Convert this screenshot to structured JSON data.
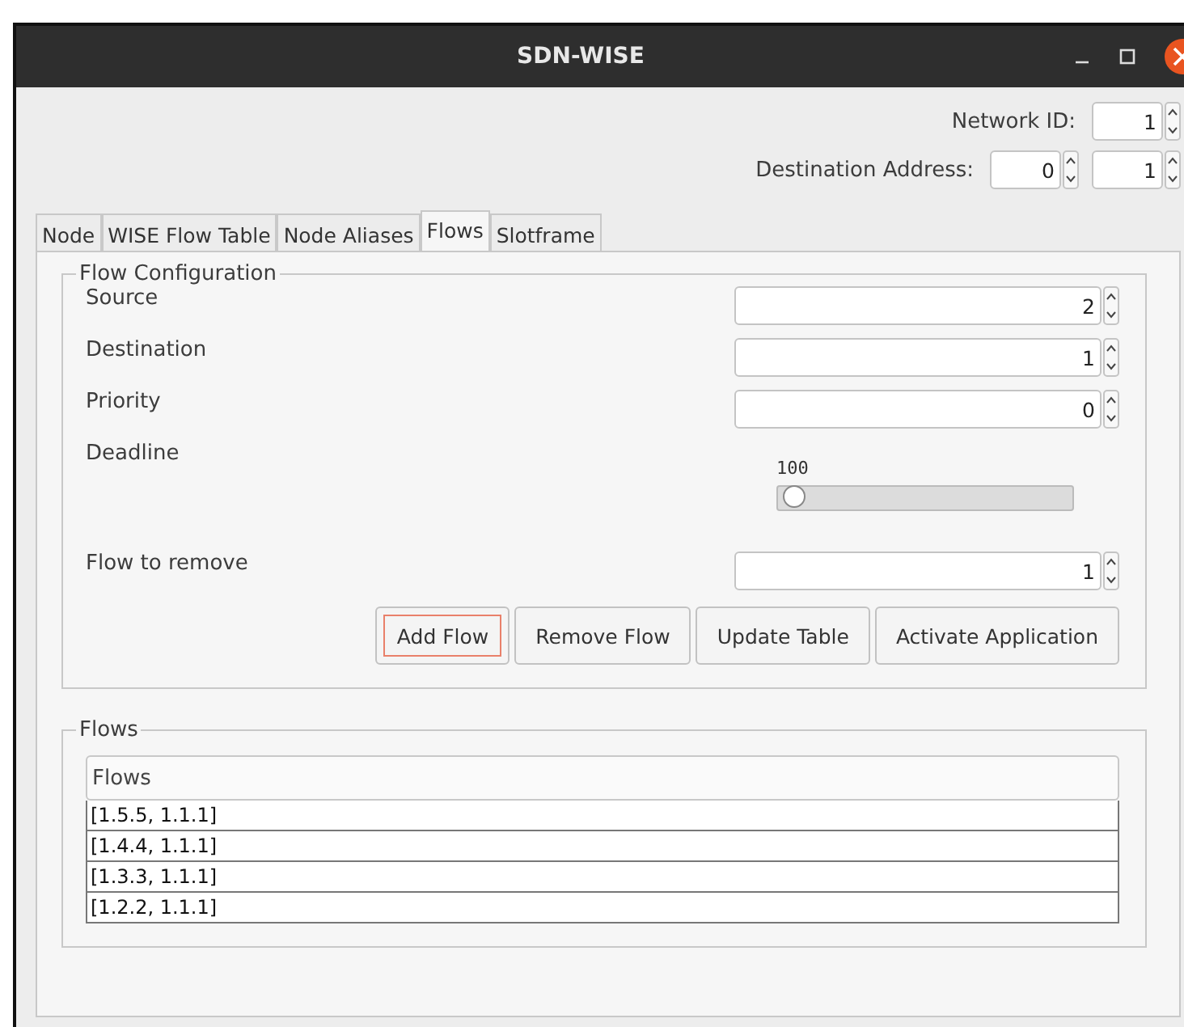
{
  "window": {
    "title": "SDN-WISE"
  },
  "header_fields": [
    {
      "label": "Network ID:",
      "values": [
        "1"
      ]
    },
    {
      "label": "Destination Address:",
      "values": [
        "0",
        "1"
      ]
    }
  ],
  "tabs": [
    {
      "label": "Node",
      "selected": false
    },
    {
      "label": "WISE Flow Table",
      "selected": false
    },
    {
      "label": "Node Aliases",
      "selected": false
    },
    {
      "label": "Flows",
      "selected": true
    },
    {
      "label": "Slotframe",
      "selected": false
    }
  ],
  "flow_configuration": {
    "title": "Flow Configuration",
    "rows": [
      {
        "kind": "spinner",
        "label": "Source",
        "value": "2"
      },
      {
        "kind": "spinner",
        "label": "Destination",
        "value": "1"
      },
      {
        "kind": "spinner",
        "label": "Priority",
        "value": "0"
      },
      {
        "kind": "slider",
        "label": "Deadline",
        "reading": "100",
        "level": 0.02
      },
      {
        "kind": "spinner",
        "label": "Flow to remove",
        "value": "1"
      }
    ],
    "buttons": [
      {
        "label": "Add Flow",
        "focused": true
      },
      {
        "label": "Remove Flow",
        "focused": false
      },
      {
        "label": "Update Table",
        "focused": false
      },
      {
        "label": "Activate Application",
        "focused": false
      }
    ]
  },
  "flows": {
    "title": "Flows",
    "column": "Flows",
    "rows": [
      "[1.5.5, 1.1.1]",
      "[1.4.4, 1.1.1]",
      "[1.3.3, 1.1.1]",
      "[1.2.2, 1.1.1]"
    ]
  }
}
